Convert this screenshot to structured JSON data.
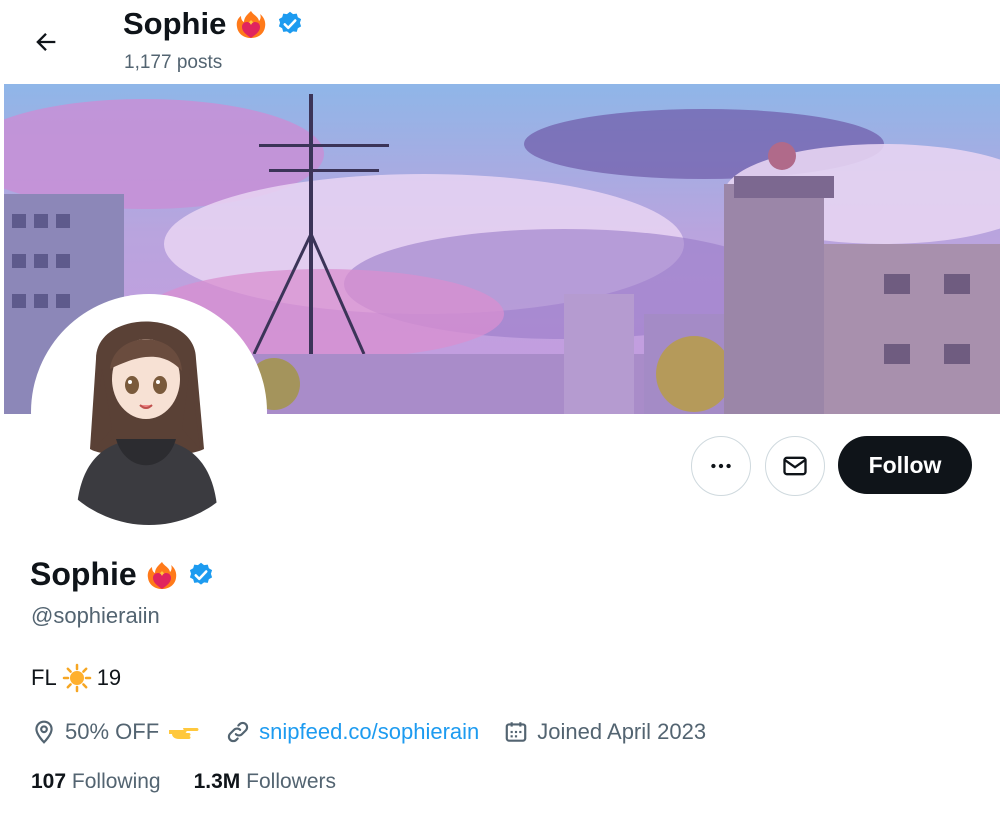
{
  "header": {
    "name": "Sophie",
    "posts": "1,177 posts"
  },
  "profile": {
    "display_name": "Sophie",
    "handle": "@sophieraiin",
    "bio_prefix": "FL",
    "bio_suffix": "19",
    "location": "50% OFF",
    "website": "snipfeed.co/sophierain",
    "joined": "Joined April 2023",
    "following_count": "107",
    "following_label": "Following",
    "followers_count": "1.3M",
    "followers_label": "Followers"
  },
  "actions": {
    "follow_label": "Follow",
    "more_icon": "more-icon",
    "message_icon": "envelope-icon"
  },
  "colors": {
    "accent": "#1d9bf0",
    "text": "#0f1419",
    "muted": "#536471",
    "follow_bg": "#0f1419"
  }
}
